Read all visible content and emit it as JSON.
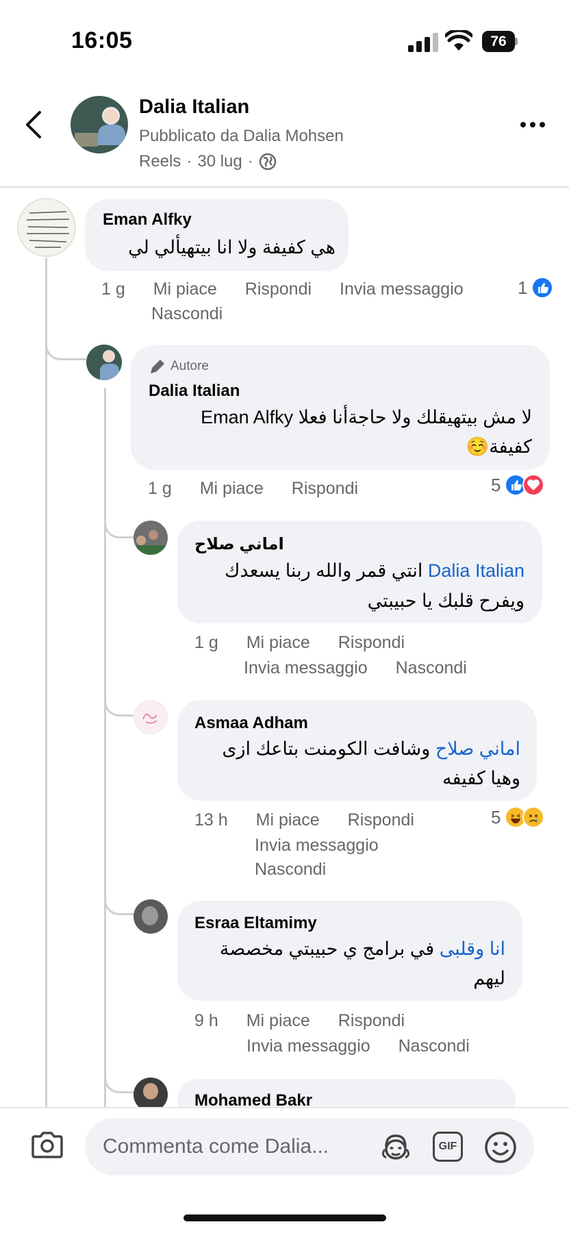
{
  "status_bar": {
    "time": "16:05",
    "battery": "76"
  },
  "header": {
    "page_name": "Dalia Italian",
    "published_by": "Pubblicato da Dalia Mohsen",
    "meta_type": "Reels",
    "meta_date": "30 lug",
    "separator": "·"
  },
  "comments": [
    {
      "author": "Eman Alfky",
      "text": "هي كفيفة ولا انا بيتهيألي لي",
      "time": "1 g",
      "actions": [
        "Mi piace",
        "Rispondi",
        "Invia messaggio",
        "Nascondi"
      ],
      "reaction_count": "1",
      "reactions": [
        "like-icon"
      ]
    },
    {
      "author_badge": "Autore",
      "author": "Dalia Italian",
      "text_line1_mention": "Eman Alfky",
      "text_line1_rest": "لا مش بيتهيقلك ولا حاجةأنا فعلا",
      "text_line2": "كفيفة☺️",
      "time": "1 g",
      "actions": [
        "Mi piace",
        "Rispondi"
      ],
      "reaction_count": "5",
      "reactions": [
        "like-icon",
        "love-icon"
      ]
    },
    {
      "author": "اماني صلاح",
      "text_line1_prefix": "انتي قمر والله ربنا يسعدك",
      "text_line1_mention": "Dalia Italian",
      "text_line2": "ويفرح قلبك يا حبيبتي",
      "time": "1 g",
      "actions": [
        "Mi piace",
        "Rispondi",
        "Invia messaggio",
        "Nascondi"
      ]
    },
    {
      "author": "Asmaa Adham",
      "text_line1_mention": "اماني صلاح",
      "text_line1_rest": "وشافت الكومنت بتاعك ازى",
      "text_line2": "وهيا كفيفه",
      "time": "13 h",
      "actions": [
        "Mi piace",
        "Rispondi",
        "Invia messaggio",
        "Nascondi"
      ],
      "reaction_count": "5",
      "reactions": [
        "haha-icon",
        "sad-icon"
      ]
    },
    {
      "author": "Esraa Eltamimy",
      "text_line1_mention": "انا وقلبى",
      "text_line1_rest": "في برامج ي حبيبتي مخصصة",
      "text_line2": "ليهم",
      "time": "9 h",
      "actions": [
        "Mi piace",
        "Rispondi",
        "Invia messaggio",
        "Nascondi"
      ]
    },
    {
      "author": "Mohamed Bakr"
    }
  ],
  "comment_bar": {
    "placeholder": "Commenta come Dalia...",
    "gif_label": "GIF"
  },
  "colors": {
    "accent": "#1877f2",
    "mention": "#1763cf",
    "bubble": "#f0f2f5",
    "secondary_text": "#65676b"
  }
}
